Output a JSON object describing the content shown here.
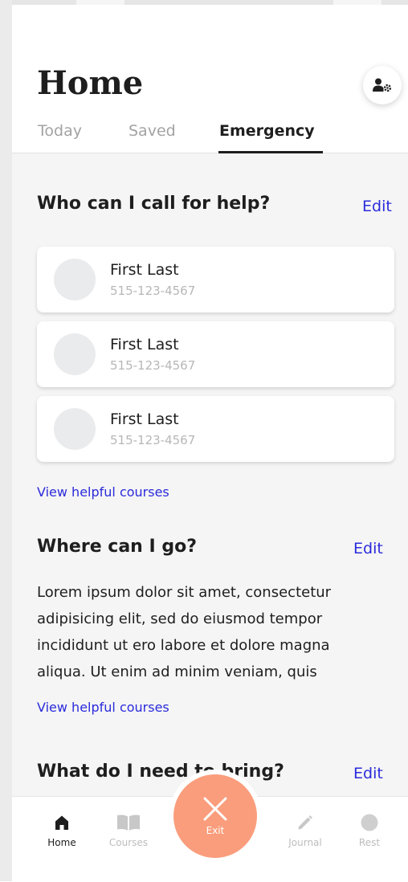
{
  "header": {
    "title": "Home",
    "profile_icon": "user-settings-icon"
  },
  "tabs": [
    {
      "label": "Today",
      "active": false
    },
    {
      "label": "Saved",
      "active": false
    },
    {
      "label": "Emergency",
      "active": true
    }
  ],
  "sections": {
    "call": {
      "title": "Who can I call for help?",
      "edit": "Edit",
      "contacts": [
        {
          "name": "First Last",
          "phone": "515-123-4567"
        },
        {
          "name": "First Last",
          "phone": "515-123-4567"
        },
        {
          "name": "First Last",
          "phone": "515-123-4567"
        }
      ],
      "link": "View helpful courses"
    },
    "go": {
      "title": "Where can I go?",
      "edit": "Edit",
      "body": "Lorem ipsum dolor sit amet, consectetur adipisicing elit, sed do eiusmod tempor incididunt ut ero labore et dolore magna aliqua. Ut enim ad minim veniam, quis",
      "link": "View helpful courses"
    },
    "bring": {
      "title": "What do I need to bring?",
      "edit": "Edit"
    }
  },
  "bottom_nav": {
    "items": [
      {
        "label": "Home",
        "icon": "home-icon",
        "active": true
      },
      {
        "label": "Courses",
        "icon": "book-icon",
        "active": false
      },
      {
        "label": "Journal",
        "icon": "pencil-icon",
        "active": false
      },
      {
        "label": "Rest",
        "icon": "circle-icon",
        "active": false
      }
    ],
    "exit": {
      "label": "Exit",
      "icon": "close-icon"
    }
  },
  "colors": {
    "accent_link": "#2b2bdc",
    "exit_button": "#fa9d7c",
    "background": "#f5f5f5",
    "text_primary": "#1e1e1e",
    "text_muted": "#a3a3a3"
  }
}
